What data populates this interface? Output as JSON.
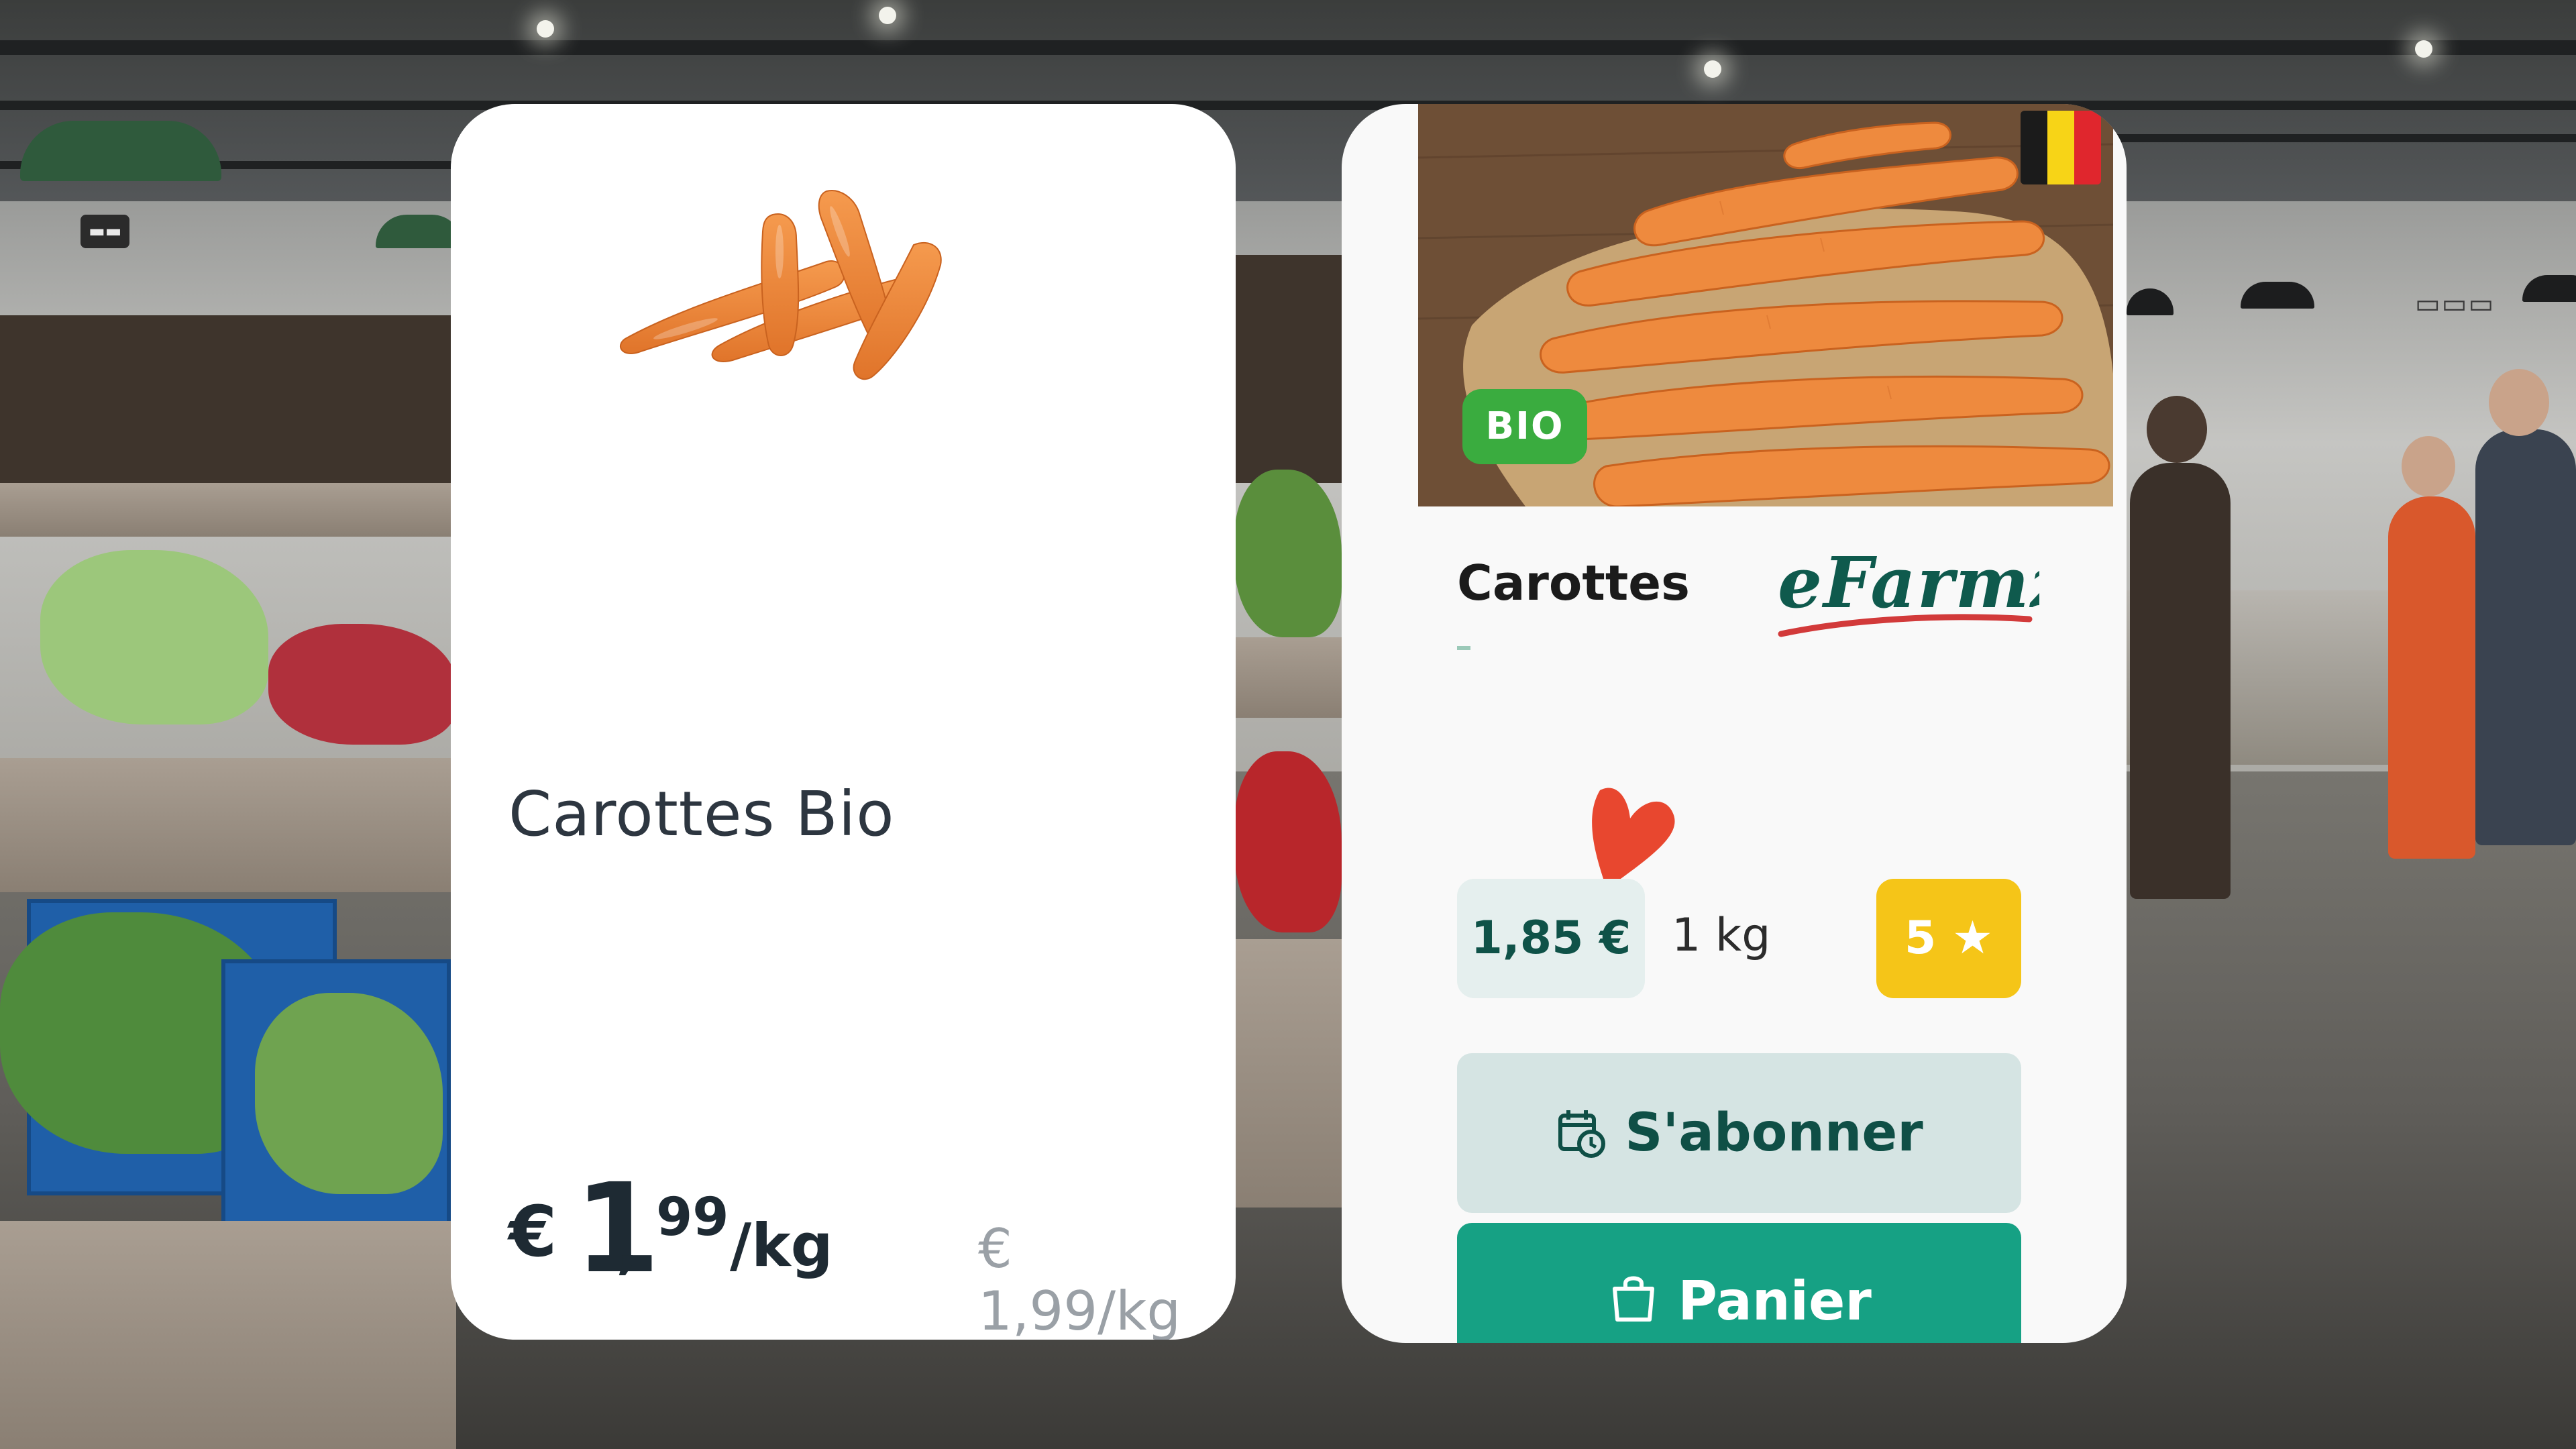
{
  "left_card": {
    "product_name": "Carottes Bio",
    "price": {
      "currency": "€",
      "integer": "1",
      "decimal_sep": ",",
      "cents": "99",
      "unit": "/kg"
    },
    "unit_price": "€ 1,99/kg",
    "image_icon": "carrots-image"
  },
  "right_card": {
    "flag_icon": "belgium-flag",
    "flag_colors": [
      "#1b1b1b",
      "#f7d417",
      "#e0262d"
    ],
    "badge": "BIO",
    "badge_color": "#3aac3f",
    "product_name": "Carottes",
    "subtitle": "-",
    "brand_logo": "eFarmz",
    "favorite_icon": "heart-icon",
    "price": "1,85 €",
    "weight": "1 kg",
    "rating": "5",
    "rating_icon": "star-icon",
    "subscribe_button": "S'abonner",
    "subscribe_icon": "calendar-clock-icon",
    "cart_button": "Panier",
    "cart_icon": "shopping-bag-icon",
    "accent_color": "#16a184",
    "heart_color": "#e8472f",
    "rating_color": "#f5c518"
  }
}
